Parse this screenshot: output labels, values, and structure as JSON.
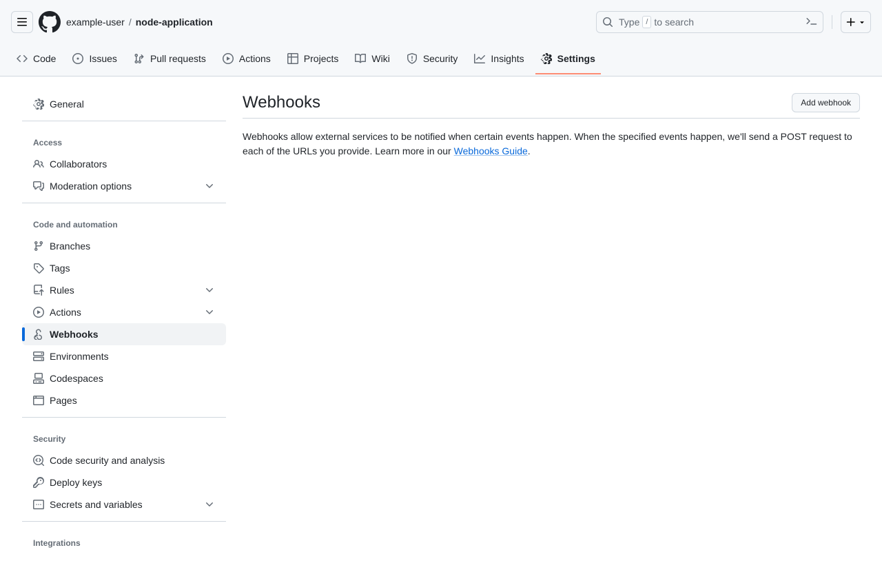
{
  "header": {
    "owner": "example-user",
    "separator": "/",
    "repo": "node-application",
    "search_placeholder_pre": "Type",
    "search_key": "/",
    "search_placeholder_post": "to search"
  },
  "repo_tabs": [
    {
      "label": "Code"
    },
    {
      "label": "Issues"
    },
    {
      "label": "Pull requests"
    },
    {
      "label": "Actions"
    },
    {
      "label": "Projects"
    },
    {
      "label": "Wiki"
    },
    {
      "label": "Security"
    },
    {
      "label": "Insights"
    },
    {
      "label": "Settings"
    }
  ],
  "sidebar": {
    "general": "General",
    "groups": [
      {
        "heading": "Access",
        "items": [
          {
            "label": "Collaborators"
          },
          {
            "label": "Moderation options",
            "expandable": true
          }
        ]
      },
      {
        "heading": "Code and automation",
        "items": [
          {
            "label": "Branches"
          },
          {
            "label": "Tags"
          },
          {
            "label": "Rules",
            "expandable": true
          },
          {
            "label": "Actions",
            "expandable": true
          },
          {
            "label": "Webhooks",
            "active": true
          },
          {
            "label": "Environments"
          },
          {
            "label": "Codespaces"
          },
          {
            "label": "Pages"
          }
        ]
      },
      {
        "heading": "Security",
        "items": [
          {
            "label": "Code security and analysis"
          },
          {
            "label": "Deploy keys"
          },
          {
            "label": "Secrets and variables",
            "expandable": true
          }
        ]
      },
      {
        "heading": "Integrations",
        "items": []
      }
    ]
  },
  "main": {
    "title": "Webhooks",
    "add_button": "Add webhook",
    "description_pre": "Webhooks allow external services to be notified when certain events happen. When the specified events happen, we'll send a POST request to each of the URLs you provide. Learn more in our ",
    "guide_link": "Webhooks Guide",
    "description_post": "."
  }
}
